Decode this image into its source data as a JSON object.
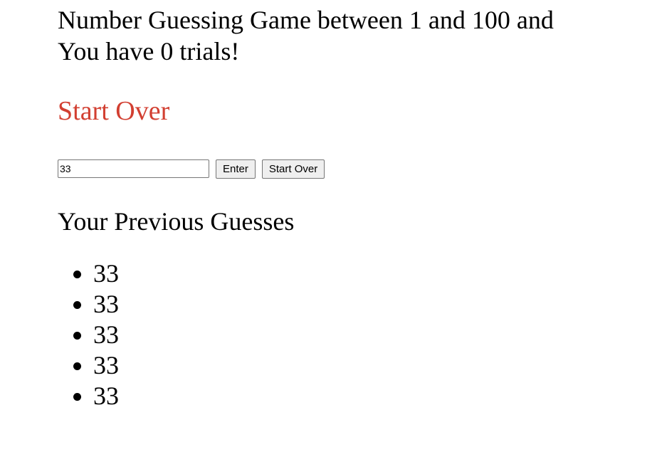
{
  "game": {
    "title": "Number Guessing Game between 1 and 100 and You have 0 trials!",
    "start_over_link": "Start Over"
  },
  "form": {
    "input_value": "33",
    "enter_label": "Enter",
    "start_over_label": "Start Over"
  },
  "previous": {
    "heading": "Your Previous Guesses",
    "guesses": [
      "33",
      "33",
      "33",
      "33",
      "33"
    ]
  },
  "colors": {
    "link": "#d23f31"
  }
}
